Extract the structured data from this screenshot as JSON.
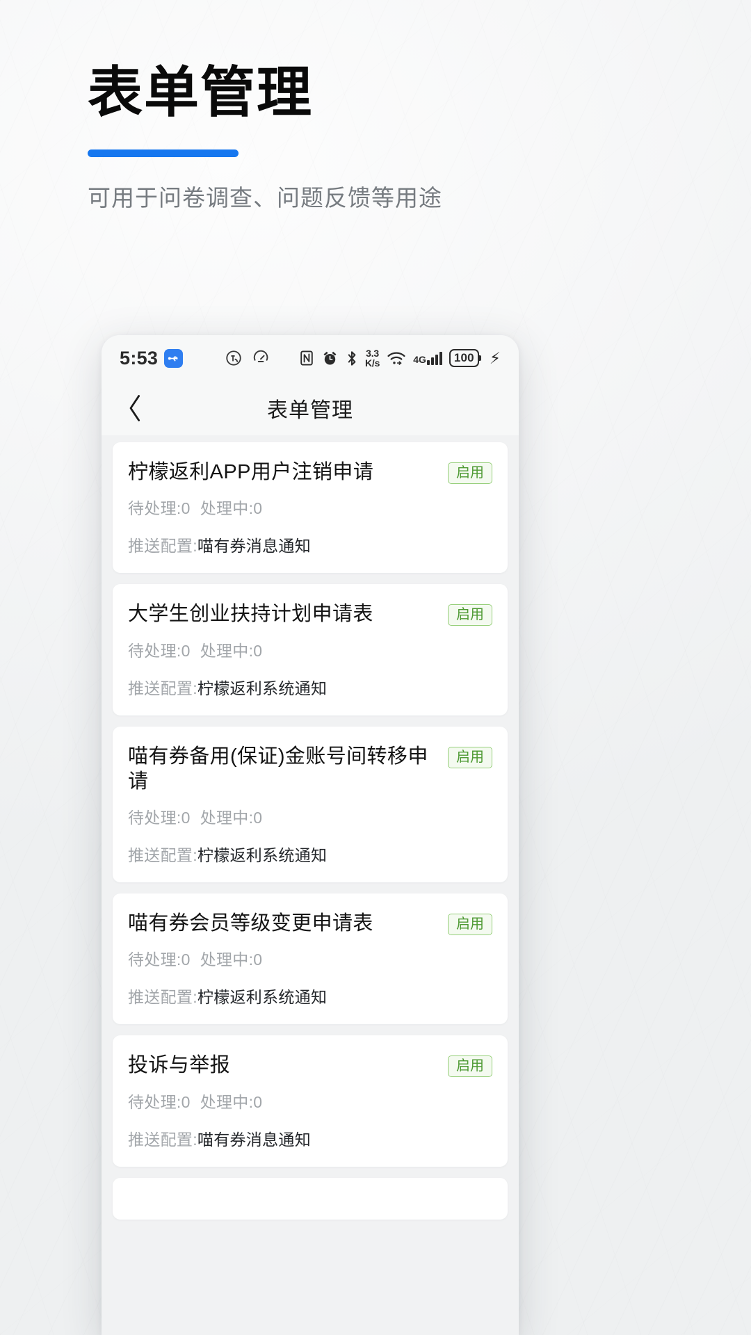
{
  "poster": {
    "title": "表单管理",
    "subtitle": "可用于问卷调查、问题反馈等用途",
    "accent_color": "#1677ef"
  },
  "phone": {
    "status_bar": {
      "time": "5:53",
      "usb_icon": "usb-icon",
      "icons_mid": [
        "alarm-volume-icon",
        "speedometer-icon"
      ],
      "icons_right": [
        "nfc-icon",
        "alarm-clock-icon",
        "bluetooth-icon"
      ],
      "network_speed_value": "3.3",
      "network_speed_unit": "K/s",
      "wifi_icon": "wifi-icon",
      "network_type": "4G",
      "signal_icon": "signal-bars-icon",
      "battery_level": "100",
      "charging_icon": "lightning-bolt-icon"
    },
    "nav": {
      "back_icon": "chevron-left-icon",
      "title": "表单管理"
    },
    "labels": {
      "pending": "待处理:",
      "processing": "处理中:",
      "push_config": "推送配置:"
    },
    "forms": [
      {
        "title": "柠檬返利APP用户注销申请",
        "status": "启用",
        "pending": "0",
        "processing": "0",
        "push_config": "喵有券消息通知"
      },
      {
        "title": "大学生创业扶持计划申请表",
        "status": "启用",
        "pending": "0",
        "processing": "0",
        "push_config": "柠檬返利系统通知"
      },
      {
        "title": "喵有券备用(保证)金账号间转移申请",
        "status": "启用",
        "pending": "0",
        "processing": "0",
        "push_config": "柠檬返利系统通知"
      },
      {
        "title": "喵有券会员等级变更申请表",
        "status": "启用",
        "pending": "0",
        "processing": "0",
        "push_config": "柠檬返利系统通知"
      },
      {
        "title": "投诉与举报",
        "status": "启用",
        "pending": "0",
        "processing": "0",
        "push_config": "喵有券消息通知"
      }
    ]
  }
}
